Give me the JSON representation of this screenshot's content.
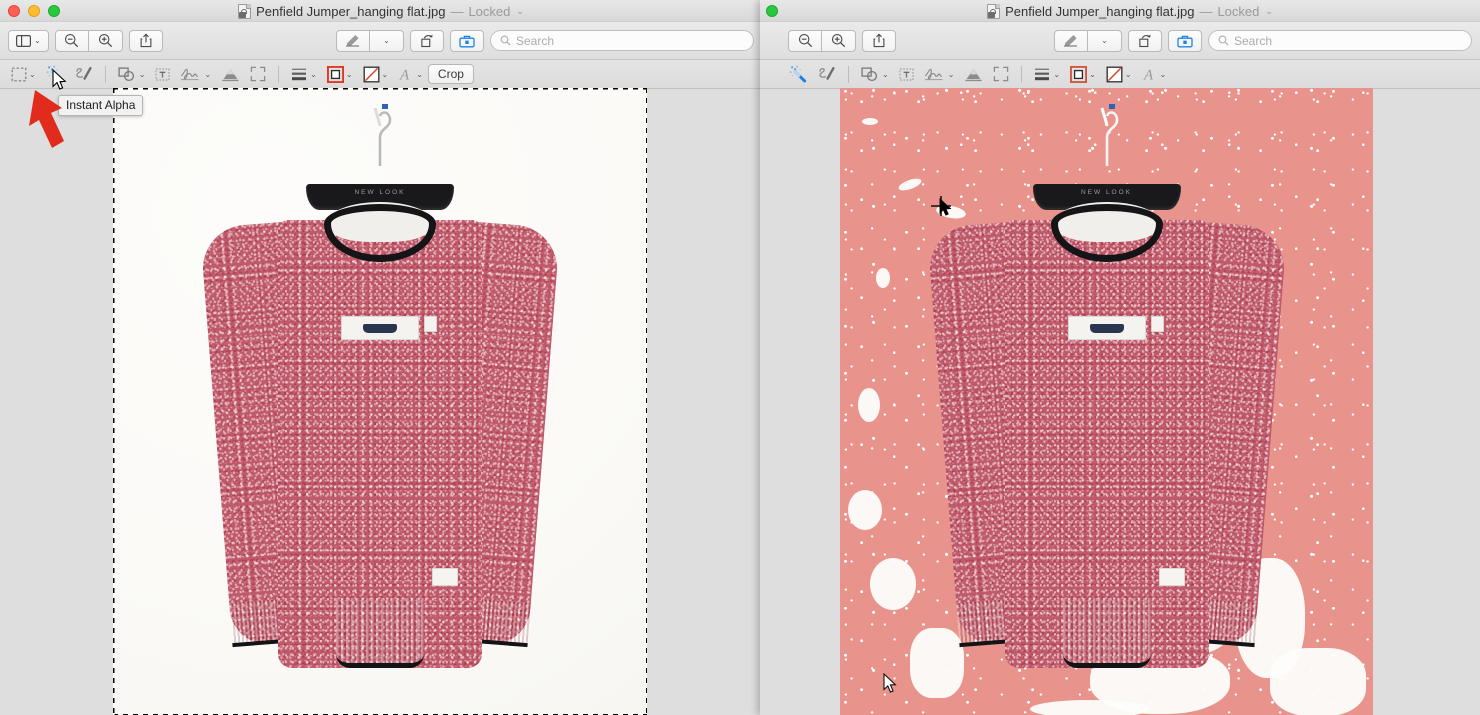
{
  "app": "Preview",
  "windows": {
    "left": {
      "title": {
        "filename": "Penfield Jumper_hanging flat.jpg",
        "separator": "—",
        "status": "Locked",
        "chevron": "⌄",
        "doc_icon": "locked-document-icon"
      },
      "traffic_lights": {
        "close": "close-window-button",
        "minimize": "minimize-window-button",
        "maximize": "maximize-window-button",
        "close_color": "#ff5f57",
        "minimize_color": "#ffbd2e",
        "maximize_color": "#28c940"
      },
      "toolbar": {
        "sidebar_label": "sidebar-view-icon",
        "zoom_out_label": "zoom-out-icon",
        "zoom_in_label": "zoom-in-icon",
        "share_label": "share-icon",
        "markup_label": "markup-pen-icon",
        "rotate_label": "rotate-left-icon",
        "toolbox_label": "markup-toolbox-icon",
        "search_placeholder": "Search",
        "search_value": ""
      },
      "markup_bar": {
        "selection_tool": "rectangular-selection-icon",
        "instant_alpha_tool": "magic-wand-icon",
        "sketch_tool": "sketch-icon",
        "shapes_tool": "shapes-icon",
        "text_tool": "text-box-icon",
        "sign_tool": "signature-icon",
        "adjust_color_tool": "adjust-color-icon",
        "adjust_size_tool": "adjust-size-icon",
        "shape_style_tool": "shape-style-icon",
        "border_color_tool": "border-color-icon",
        "fill_color_tool": "fill-color-icon",
        "text_style_tool": "text-style-icon",
        "crop_label": "Crop"
      }
    },
    "right": {
      "title": {
        "filename": "Penfield Jumper_hanging flat.jpg",
        "separator": "—",
        "status": "Locked",
        "chevron": "⌄",
        "doc_icon": "locked-document-icon"
      },
      "traffic_lights": {
        "maximize": "maximize-window-button",
        "maximize_color": "#28c940"
      },
      "toolbar": {
        "zoom_out_label": "zoom-out-icon",
        "zoom_in_label": "zoom-in-icon",
        "share_label": "share-icon",
        "markup_label": "markup-pen-icon",
        "rotate_label": "rotate-left-icon",
        "toolbox_label": "markup-toolbox-icon",
        "search_placeholder": "Search",
        "search_value": ""
      },
      "markup_bar": {
        "instant_alpha_tool": "magic-wand-icon",
        "sketch_tool": "sketch-icon",
        "shapes_tool": "shapes-icon",
        "text_tool": "text-box-icon",
        "sign_tool": "signature-icon",
        "adjust_color_tool": "adjust-color-icon",
        "adjust_size_tool": "adjust-size-icon",
        "shape_style_tool": "shape-style-icon",
        "border_color_tool": "border-color-icon",
        "fill_color_tool": "fill-color-icon",
        "text_style_tool": "text-style-icon"
      }
    }
  },
  "annotation": {
    "tooltip_text": "Instant Alpha",
    "arrow_color": "#e02b1d",
    "arrow_name": "red-pointer-arrow"
  },
  "image_content": {
    "subject": "Penfield knitted jumper hanging flat on a black hanger",
    "hanger_brand_text": "NEW LOOK",
    "left_background": "#fbfaf7",
    "right_background_keyed": "#e8948c",
    "knit_color": "#c0596a",
    "hanger_color": "#19191b",
    "selection_state": "marching-ants selection around jumper"
  },
  "cursors": {
    "left_pointer": "arrow-cursor",
    "right_crosshair": "crosshair-cursor",
    "right_pointer": "arrow-cursor"
  }
}
